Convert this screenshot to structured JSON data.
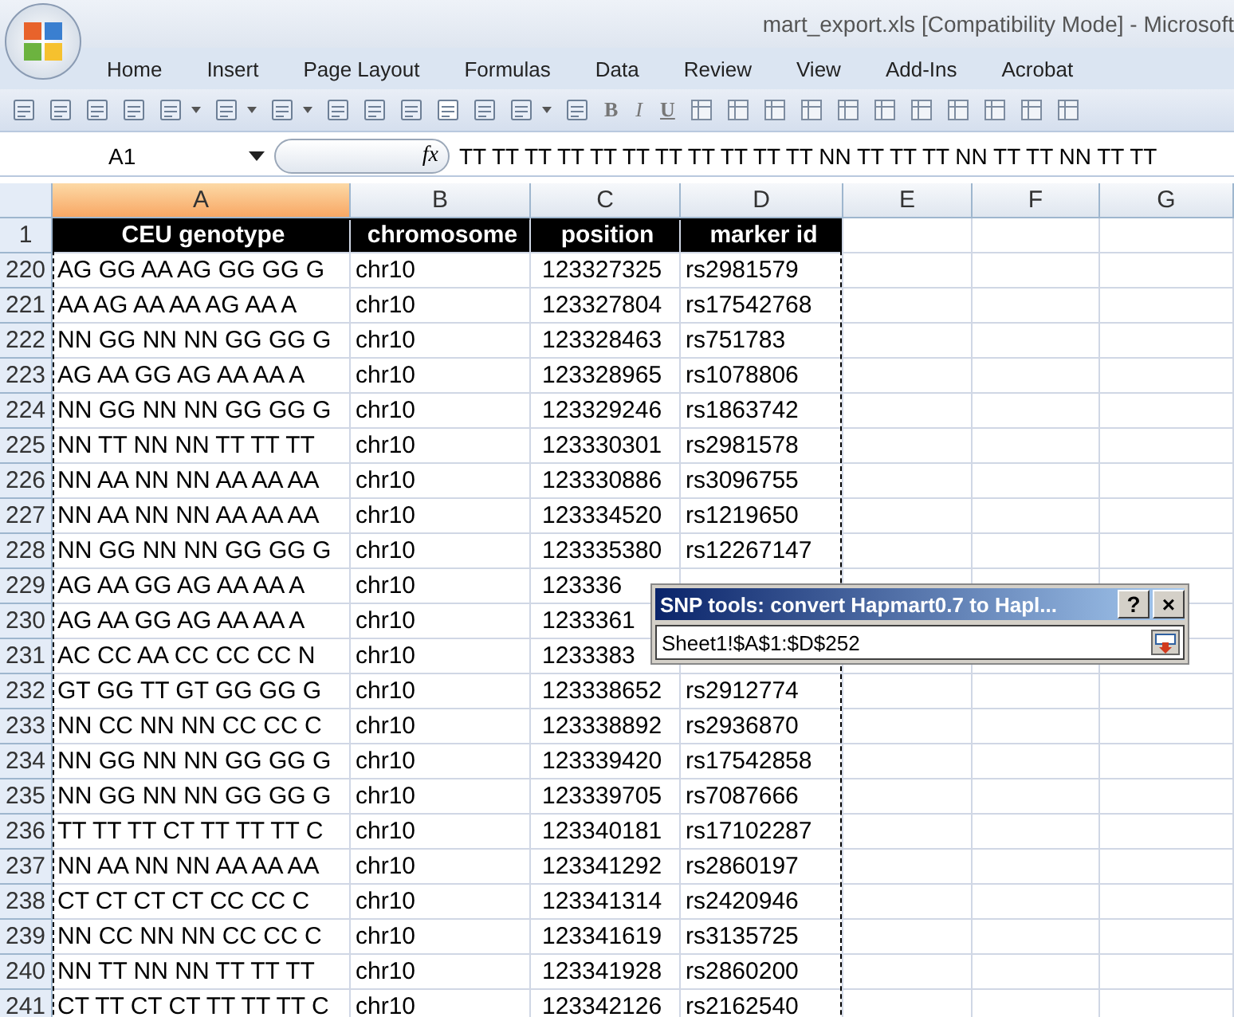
{
  "window": {
    "title": "mart_export.xls  [Compatibility Mode] - Microsoft"
  },
  "ribbon_tabs": [
    {
      "label": "Home",
      "selected": false
    },
    {
      "label": "Insert",
      "selected": false
    },
    {
      "label": "Page Layout",
      "selected": false
    },
    {
      "label": "Formulas",
      "selected": false
    },
    {
      "label": "Data",
      "selected": false
    },
    {
      "label": "Review",
      "selected": false
    },
    {
      "label": "View",
      "selected": false
    },
    {
      "label": "Add-Ins",
      "selected": false
    },
    {
      "label": "Acrobat",
      "selected": false
    }
  ],
  "format_buttons": [
    "B",
    "I",
    "U"
  ],
  "formula_bar": {
    "name_box": "A1",
    "fx": "fx",
    "value": "TT TT TT TT TT TT TT TT TT TT TT NN TT TT TT NN TT TT NN TT TT"
  },
  "columns": [
    {
      "label": "A",
      "selected": true
    },
    {
      "label": "B",
      "selected": false
    },
    {
      "label": "C",
      "selected": false
    },
    {
      "label": "D",
      "selected": false
    },
    {
      "label": "E",
      "selected": false
    },
    {
      "label": "F",
      "selected": false
    },
    {
      "label": "G",
      "selected": false
    }
  ],
  "header_row": {
    "number": "1",
    "cells": [
      "CEU genotype",
      "chromosome",
      "position",
      "marker id"
    ]
  },
  "rows": [
    {
      "number": "220",
      "cells": [
        "AG GG AA AG GG GG G",
        "chr10",
        "123327325",
        "rs2981579"
      ]
    },
    {
      "number": "221",
      "cells": [
        "AA AG AA AA AG AA A",
        "chr10",
        "123327804",
        "rs17542768"
      ]
    },
    {
      "number": "222",
      "cells": [
        "NN GG NN NN GG GG G",
        "chr10",
        "123328463",
        "rs751783"
      ]
    },
    {
      "number": "223",
      "cells": [
        "AG AA GG AG AA AA A",
        "chr10",
        "123328965",
        "rs1078806"
      ]
    },
    {
      "number": "224",
      "cells": [
        "NN GG NN NN GG GG G",
        "chr10",
        "123329246",
        "rs1863742"
      ]
    },
    {
      "number": "225",
      "cells": [
        "NN TT NN NN TT TT TT",
        "chr10",
        "123330301",
        "rs2981578"
      ]
    },
    {
      "number": "226",
      "cells": [
        "NN AA NN NN AA AA AA",
        "chr10",
        "123330886",
        "rs3096755"
      ]
    },
    {
      "number": "227",
      "cells": [
        "NN AA NN NN AA AA AA",
        "chr10",
        "123334520",
        "rs1219650"
      ]
    },
    {
      "number": "228",
      "cells": [
        "NN GG NN NN GG GG G",
        "chr10",
        "123335380",
        "rs12267147"
      ]
    },
    {
      "number": "229",
      "cells": [
        "AG AA GG AG AA AA A",
        "chr10",
        "123336",
        ""
      ]
    },
    {
      "number": "230",
      "cells": [
        "AG AA GG AG AA AA A",
        "chr10",
        "1233361",
        ""
      ]
    },
    {
      "number": "231",
      "cells": [
        "AC CC AA CC CC CC N",
        "chr10",
        "1233383",
        ""
      ]
    },
    {
      "number": "232",
      "cells": [
        "GT GG TT GT GG GG G",
        "chr10",
        "123338652",
        "rs2912774"
      ]
    },
    {
      "number": "233",
      "cells": [
        "NN CC NN NN CC CC C",
        "chr10",
        "123338892",
        "rs2936870"
      ]
    },
    {
      "number": "234",
      "cells": [
        "NN GG NN NN GG GG G",
        "chr10",
        "123339420",
        "rs17542858"
      ]
    },
    {
      "number": "235",
      "cells": [
        "NN GG NN NN GG GG G",
        "chr10",
        "123339705",
        "rs7087666"
      ]
    },
    {
      "number": "236",
      "cells": [
        "TT TT TT CT TT TT TT C",
        "chr10",
        "123340181",
        "rs17102287"
      ]
    },
    {
      "number": "237",
      "cells": [
        "NN AA NN NN AA AA AA",
        "chr10",
        "123341292",
        "rs2860197"
      ]
    },
    {
      "number": "238",
      "cells": [
        "CT CT CT CT CC CC C",
        "chr10",
        "123341314",
        "rs2420946"
      ]
    },
    {
      "number": "239",
      "cells": [
        "NN CC NN NN CC CC C",
        "chr10",
        "123341619",
        "rs3135725"
      ]
    },
    {
      "number": "240",
      "cells": [
        "NN TT NN NN TT TT TT",
        "chr10",
        "123341928",
        "rs2860200"
      ]
    },
    {
      "number": "241",
      "cells": [
        "CT TT CT CT TT TT TT C",
        "chr10",
        "123342126",
        "rs2162540"
      ]
    }
  ],
  "dialog": {
    "title": "SNP tools: convert Hapmart0.7 to Hapl...",
    "help": "?",
    "close": "×",
    "range": "Sheet1!$A$1:$D$252"
  }
}
